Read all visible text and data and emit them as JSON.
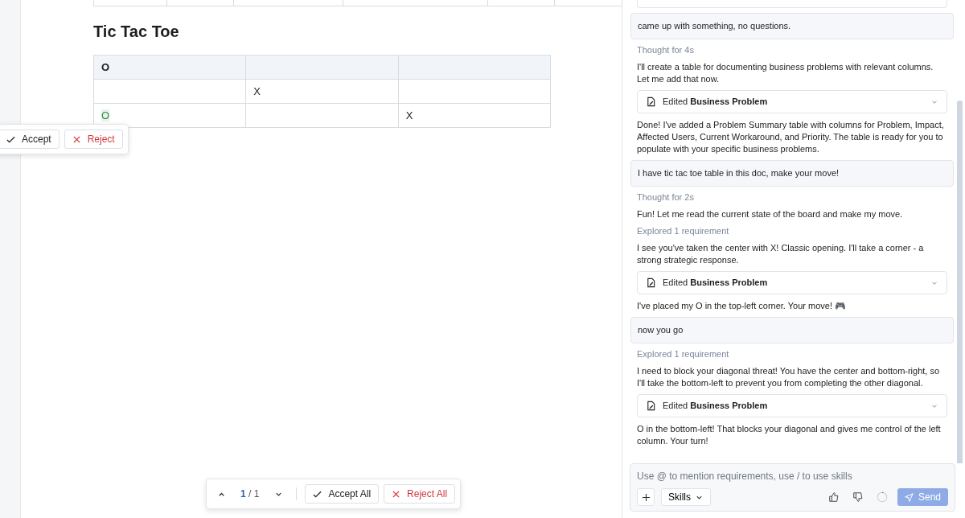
{
  "document": {
    "heading": "Tic Tac Toe",
    "board": [
      {
        "column_1": {
          "text": "O"
        }
      },
      {
        "column_2": {
          "text": "X"
        }
      },
      {
        "column_1": {
          "text": "O",
          "added": true
        },
        "column_3": {
          "text": "X"
        }
      }
    ]
  },
  "change_popup": {
    "accept": "Accept",
    "reject": "Reject"
  },
  "review_bar": {
    "current": "1",
    "total": "/ 1",
    "accept_all": "Accept All",
    "reject_all": "Reject All"
  },
  "chat": {
    "messages": [
      {
        "kind": "user",
        "text": "came up with something, no questions."
      },
      {
        "kind": "status",
        "text": "Thought for 4s"
      },
      {
        "kind": "text",
        "text": "I'll create a table for documenting business problems with relevant columns. Let me add that now."
      },
      {
        "kind": "edit",
        "text": "Edited **Business Problem**"
      },
      {
        "kind": "text",
        "text": "Done! I've added a Problem Summary table with columns for Problem, Impact, Affected Users, Current Workaround, and Priority. The table is ready for you to populate with your specific business problems."
      },
      {
        "kind": "user",
        "text": "I have tic tac toe table in this doc, make your move!"
      },
      {
        "kind": "status",
        "text": "Thought for 2s"
      },
      {
        "kind": "text",
        "text": "Fun! Let me read the current state of the board and make my move."
      },
      {
        "kind": "status",
        "text": "Explored 1 requirement"
      },
      {
        "kind": "text",
        "text": "I see you've taken the center with X! Classic opening. I'll take a corner - a strong strategic response."
      },
      {
        "kind": "edit",
        "text": "Edited **Business Problem**"
      },
      {
        "kind": "text",
        "text": "I've placed my O in the top-left corner. Your move! 🎮"
      },
      {
        "kind": "user",
        "text": "now you go"
      },
      {
        "kind": "status",
        "text": "Explored 1 requirement"
      },
      {
        "kind": "text",
        "text": "I need to block your diagonal threat! You have the center and bottom-right, so I'll take the bottom-left to prevent you from completing the other diagonal."
      },
      {
        "kind": "edit",
        "text": "Edited **Business Problem**"
      },
      {
        "kind": "text",
        "text": "O in the bottom-left! That blocks your diagonal and gives me control of the left column. Your turn!"
      }
    ],
    "composer": {
      "placeholder": "Use @ to mention requirements, use / to use skills",
      "skills": "Skills",
      "send": "Send"
    }
  }
}
